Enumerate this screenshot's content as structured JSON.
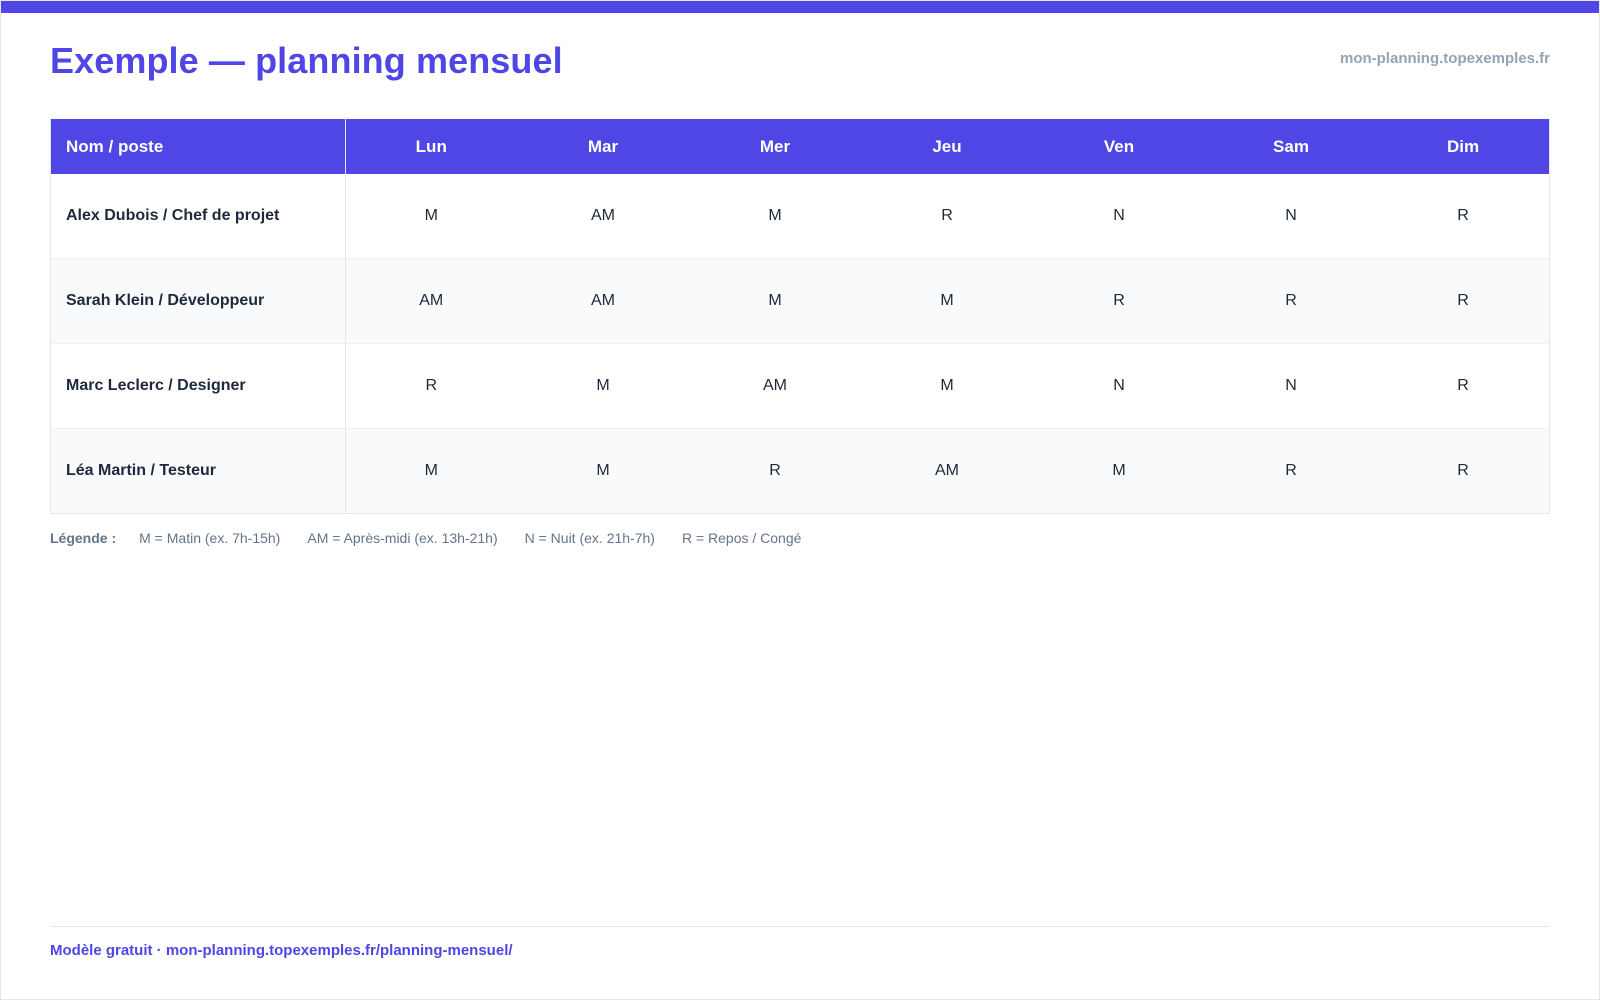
{
  "header": {
    "title": "Exemple — planning mensuel",
    "site": "mon-planning.topexemples.fr"
  },
  "colors": {
    "accent": "#4f46e5",
    "muted": "#94a3b8",
    "text": "#1e293b",
    "stripe": "#f8fafc"
  },
  "table": {
    "columns": [
      "Nom / poste",
      "Lun",
      "Mar",
      "Mer",
      "Jeu",
      "Ven",
      "Sam",
      "Dim"
    ],
    "rows": [
      {
        "name": "Alex Dubois / Chef de projet",
        "shifts": [
          "M",
          "AM",
          "M",
          "R",
          "N",
          "N",
          "R"
        ]
      },
      {
        "name": "Sarah Klein / Développeur",
        "shifts": [
          "AM",
          "AM",
          "M",
          "M",
          "R",
          "R",
          "R"
        ]
      },
      {
        "name": "Marc Leclerc / Designer",
        "shifts": [
          "R",
          "M",
          "AM",
          "M",
          "N",
          "N",
          "R"
        ]
      },
      {
        "name": "Léa Martin / Testeur",
        "shifts": [
          "M",
          "M",
          "R",
          "AM",
          "M",
          "R",
          "R"
        ]
      }
    ]
  },
  "legend": {
    "title": "Légende :",
    "items": [
      "M = Matin (ex. 7h-15h)",
      "AM = Après-midi (ex. 13h-21h)",
      "N = Nuit (ex. 21h-7h)",
      "R = Repos / Congé"
    ]
  },
  "footer": {
    "text": "Modèle gratuit · mon-planning.topexemples.fr/planning-mensuel/"
  }
}
